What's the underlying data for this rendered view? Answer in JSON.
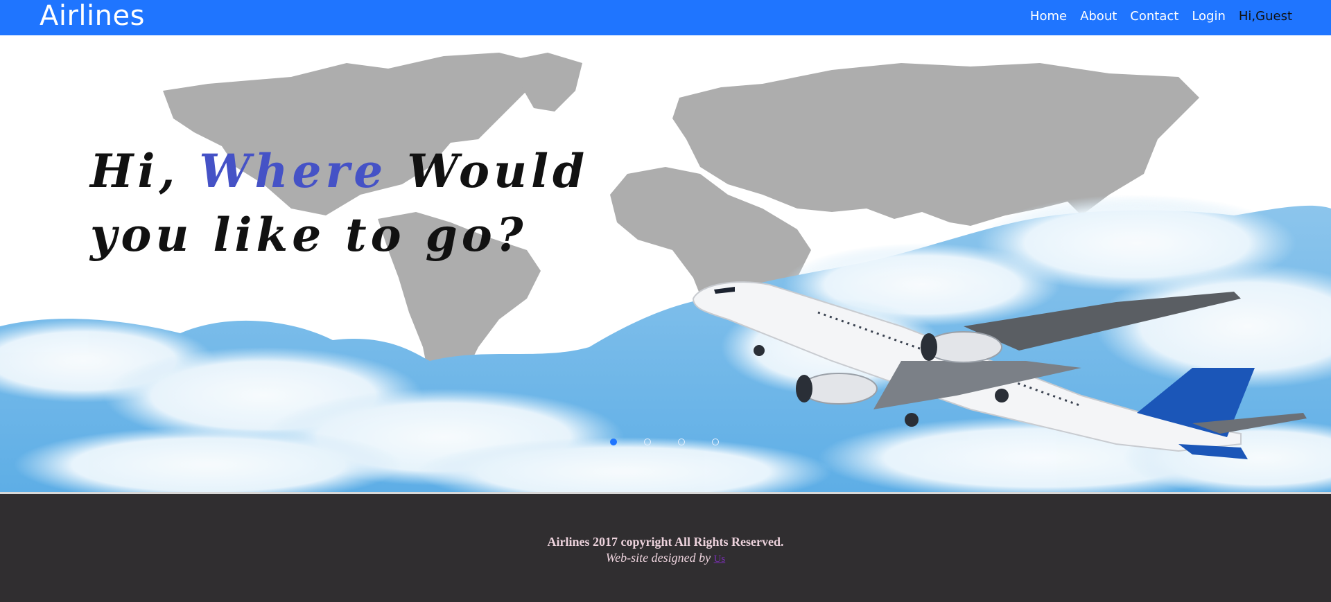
{
  "navbar": {
    "brand": "Airlines",
    "links": [
      "Home",
      "About",
      "Contact",
      "Login"
    ],
    "greeting": "Hi,Guest",
    "background": "#1f75ff"
  },
  "hero": {
    "headline_prefix": "Hi, ",
    "headline_accent": "Where",
    "headline_rest": " Would",
    "headline_line2": "you like to go?",
    "accent_color": "#4552c6",
    "image": "world-map-with-airplane-and-clouds",
    "carousel": {
      "slides": 4,
      "active_slide": 1
    }
  },
  "footer": {
    "copyright": "Airlines 2017 copyright All Rights Reserved.",
    "designed_by": "Web-site designed by ",
    "designer_link": "Us",
    "background": "#302e30"
  }
}
